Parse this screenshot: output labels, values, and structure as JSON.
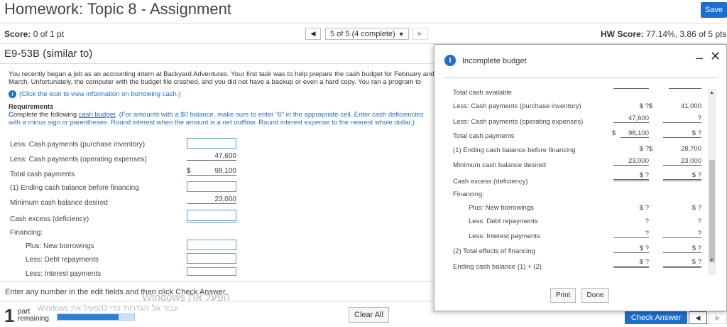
{
  "header": {
    "title": "Homework: Topic 8 - Assignment",
    "save_label": "Save"
  },
  "score_bar": {
    "score_label": "Score:",
    "score_value": "0 of 1 pt",
    "nav_selector": "5 of 5 (4 complete)",
    "hw_score_label": "HW Score:",
    "hw_score_value": "77.14%, 3.86 of 5 pts"
  },
  "exercise": {
    "title": "E9-53B (similar to)"
  },
  "question": {
    "intro": "You recently began a job as an accounting intern at Backyard Adventures. Your first task was to help prepare the cash budget for February and March. Unfortunately, the computer with the budget file crashed, and you did not have a backup or even a hard copy. You ran a program to salvage bits of data from the budget file. After entering the following data in the budget, you may have to prepare the cash budget for the remaining data.",
    "info_link": "(Click the icon to view information on borrowing cash.)",
    "requirements_title": "Requirements",
    "req_part1": "Complete the following ",
    "req_link": "cash budget",
    "req_part2": ". (For amounts with a $0 balance, make sure to enter \"0\" in the appropriate cell. Enter cash deficiencies with a minus sign or parentheses. Round interest when the amount is a net outflow. Round interest expense to the nearest whole dollar.)"
  },
  "budget_rows": {
    "purchase": "Less: Cash payments (purchase inventory)",
    "operating": "Less: Cash payments (operating expenses)",
    "operating_value": "47,600",
    "total_payments": "Total cash payments",
    "total_payments_dollar": "$",
    "total_payments_value": "98,100",
    "ending_before": "(1) Ending cash balance before financing",
    "min_desired": "Minimum cash balance desired",
    "min_desired_value": "23,000",
    "excess": "Cash excess (deficiency)",
    "financing": "Financing:",
    "new_borrowings": "Plus: New borrowings",
    "debt_repayments": "Less: Debt repayments",
    "interest_payments": "Less: Interest payments"
  },
  "footer": {
    "enter_any": "Enter any number in the edit fields and then click Check Answer.",
    "watermark": "Windows ‫הפעל את",
    "watermark2": "Windows עבור אל 'הגדרות' כדי להפעיל את",
    "part_number": "1",
    "part_label": "part",
    "remaining_label": "remaining",
    "progress": 0.8,
    "clear_all": "Clear All",
    "check_answer": "Check Answer"
  },
  "modal": {
    "title": "Incomplete budget",
    "rows": {
      "total_available": "Total cash available",
      "purchase": "Less: Cash payments (purchase inventory)",
      "purchase_v1": "$ ?",
      "purchase_d2": "$",
      "purchase_v2": "41,000",
      "operating": "Less: Cash payments (operating expenses)",
      "operating_v1": "47,600",
      "operating_v2": "?",
      "total_payments": "Total cash payments",
      "total_payments_d1": "$",
      "total_payments_v1": "98,100",
      "total_payments_v2": "$ ?",
      "ending_before": "(1) Ending cash balance before financing",
      "ending_before_v1": "$ ?",
      "ending_before_d2": "$",
      "ending_before_v2": "28,700",
      "min_desired": "Minimum cash balance desired",
      "min_desired_v1": "23,000",
      "min_desired_v2": "23,000",
      "excess": "Cash excess (deficiency)",
      "excess_v1": "$ ?",
      "excess_v2": "$ ?",
      "financing": "Financing:",
      "new_borrowings": "Plus: New borrowings",
      "new_borrowings_v1": "$ ?",
      "new_borrowings_v2": "$ ?",
      "debt_repayments": "Less: Debt repayments",
      "debt_repayments_v1": "?",
      "debt_repayments_v2": "?",
      "interest_payments": "Less: Interest payments",
      "interest_payments_v1": "?",
      "interest_payments_v2": "?",
      "total_effects": "(2) Total effects of financing",
      "total_effects_v1": "$ ?",
      "total_effects_v2": "$ ?",
      "ending_balance": "Ending cash balance (1) + (2)",
      "ending_balance_v1": "$ ?",
      "ending_balance_v2": "$ ?"
    },
    "print_label": "Print",
    "done_label": "Done"
  }
}
